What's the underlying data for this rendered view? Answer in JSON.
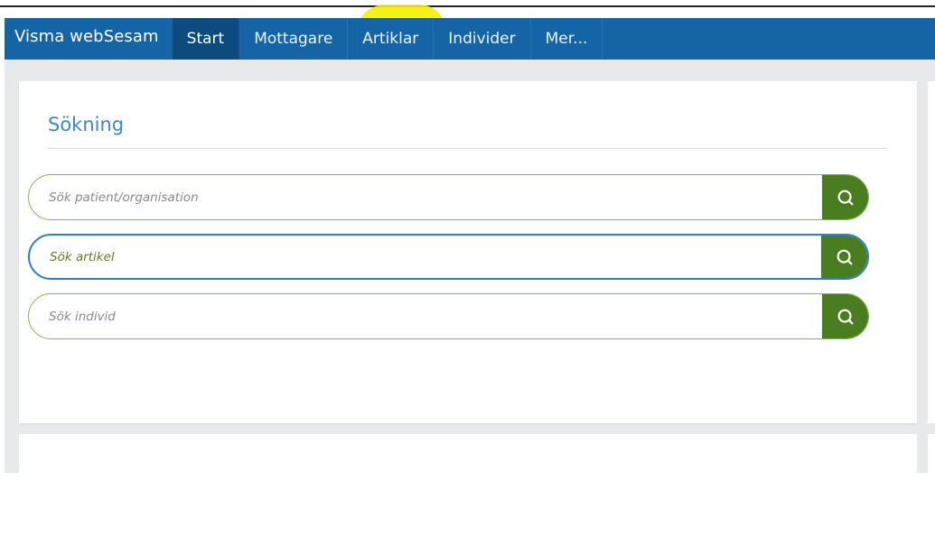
{
  "navbar": {
    "brand": "Visma webSesam",
    "items": [
      {
        "label": "Start",
        "active": true
      },
      {
        "label": "Mottagare",
        "active": false
      },
      {
        "label": "Artiklar",
        "active": false
      },
      {
        "label": "Individer",
        "active": false
      },
      {
        "label": "Mer...",
        "active": false
      }
    ]
  },
  "search_card": {
    "title": "Sökning",
    "fields": [
      {
        "placeholder": "Sök patient/organisation",
        "value": ""
      },
      {
        "placeholder": "Sök artikel",
        "value": ""
      },
      {
        "placeholder": "Sök individ",
        "value": ""
      }
    ],
    "search_icon": "search-icon"
  },
  "colors": {
    "nav_bg": "#1565a6",
    "nav_active": "#0d4a7e",
    "title_blue": "#3d86c6",
    "field_border": "#8ab153",
    "focus_border": "#2e7bcf",
    "button_green": "#4a7d1f",
    "highlight_yellow": "#f2f200"
  }
}
